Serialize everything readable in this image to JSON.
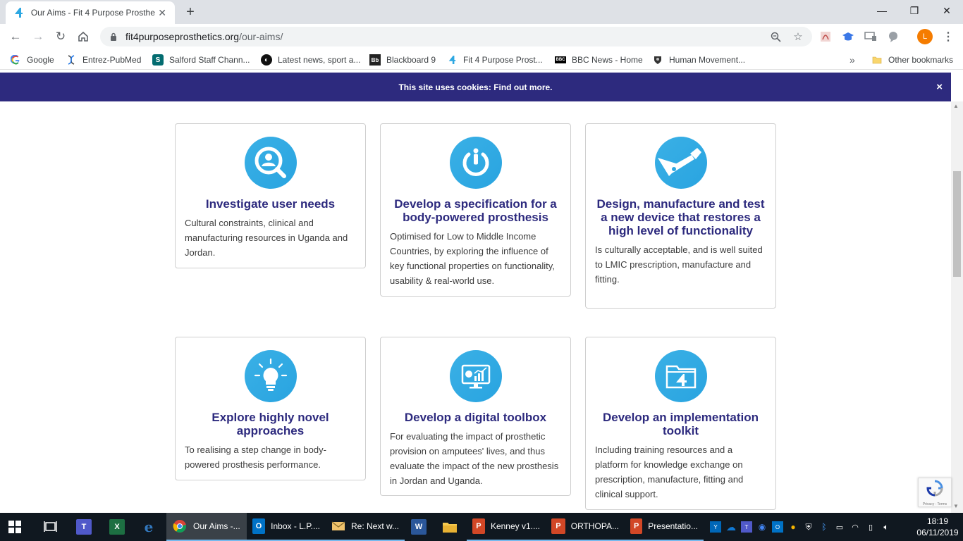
{
  "browser": {
    "tab_title": "Our Aims - Fit 4 Purpose Prosthe",
    "url_domain": "fit4purposeprosthetics.org",
    "url_path": "/our-aims/",
    "profile_initial": "L",
    "bookmarks": [
      {
        "label": "Google",
        "icon": "google-icon"
      },
      {
        "label": "Entrez-PubMed",
        "icon": "dna-icon"
      },
      {
        "label": "Salford Staff Chann...",
        "icon": "sharepoint-icon"
      },
      {
        "label": "Latest news, sport a...",
        "icon": "news-icon"
      },
      {
        "label": "Blackboard 9",
        "icon": "blackboard-icon"
      },
      {
        "label": "Fit 4 Purpose Prost...",
        "icon": "f4p-icon"
      },
      {
        "label": "BBC News - Home",
        "icon": "bbc-icon"
      },
      {
        "label": "Human Movement...",
        "icon": "crest-icon"
      }
    ],
    "overflow": "»",
    "other_bookmarks": "Other bookmarks"
  },
  "cookie_banner": {
    "text": "This site uses cookies: Find out more.",
    "close": "×"
  },
  "aims": [
    {
      "title": "Investigate user needs",
      "text": "Cultural constraints, clinical and manufacturing resources in Uganda and Jordan.",
      "icon": "user-search-icon"
    },
    {
      "title": "Develop a specification for a body-powered prosthesis",
      "text": "Optimised for Low to Middle Income Countries, by exploring the influence of key functional properties on functionality, usability & real-world use.",
      "icon": "power-person-icon"
    },
    {
      "title": "Design, manufacture and test a new device that restores a high level of functionality",
      "text": "Is culturally acceptable, and is well suited to LMIC prescription, manufacture and fitting.",
      "icon": "prosthetic-arm-icon"
    },
    {
      "title": "Explore highly novel approaches",
      "text": "To realising a step change in body-powered prosthesis performance.",
      "icon": "lightbulb-icon"
    },
    {
      "title": "Develop a digital toolbox",
      "text": "For evaluating the impact of prosthetic provision on amputees' lives, and thus evaluate the impact of the new prosthesis in Jordan and Uganda.",
      "icon": "dashboard-icon"
    },
    {
      "title": "Develop an implementation toolkit",
      "text": "Including training resources and a platform for knowledge exchange on prescription, manufacture, fitting and clinical support.",
      "icon": "folder-four-icon"
    }
  ],
  "recaptcha": {
    "text": "Privacy - Terms"
  },
  "taskbar": {
    "apps": [
      {
        "label": "Our Aims -...",
        "icon": "chrome-icon"
      },
      {
        "label": "Inbox - L.P....",
        "icon": "outlook-icon"
      },
      {
        "label": "Re: Next w...",
        "icon": "mail-icon"
      },
      {
        "label": "Kenney v1....",
        "icon": "powerpoint-icon"
      },
      {
        "label": "ORTHOPA...",
        "icon": "powerpoint-icon"
      },
      {
        "label": "Presentatio...",
        "icon": "powerpoint-icon"
      }
    ],
    "time": "18:19",
    "date": "06/11/2019"
  },
  "colors": {
    "brand_navy": "#2d2a7e",
    "icon_blue": "#2ea8e2",
    "taskbar": "#101820"
  }
}
